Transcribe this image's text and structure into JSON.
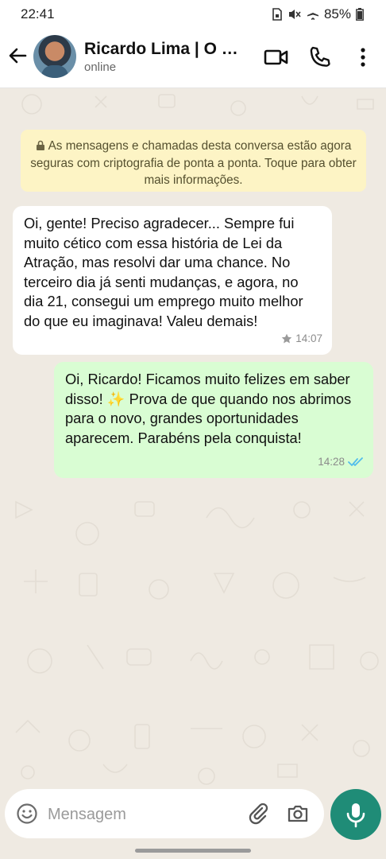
{
  "statusbar": {
    "time": "22:41",
    "battery": "85%"
  },
  "header": {
    "name": "Ricardo Lima | O D...",
    "status": "online"
  },
  "encryption_notice": "As mensagens e chamadas desta conversa estão agora seguras com criptografia de ponta a ponta. Toque para obter mais informações.",
  "messages": [
    {
      "text": "Oi, gente! Preciso agradecer... Sempre fui muito cético com essa história de Lei da Atração, mas resolvi dar uma chance. No terceiro dia já senti mudanças, e agora, no dia 21, consegui um emprego muito melhor do que eu imaginava! Valeu demais!",
      "time": "14:07"
    },
    {
      "text": "Oi, Ricardo! Ficamos muito felizes em saber disso! ✨ Prova de que quando nos abrimos para o novo, grandes oportunidades aparecem. Parabéns pela conquista!",
      "time": "14:28"
    }
  ],
  "composer": {
    "placeholder": "Mensagem"
  },
  "colors": {
    "accent": "#1f8c77",
    "incoming": "#ffffff",
    "outgoing": "#d9fdd3",
    "notice": "#fdf4c5",
    "read_ticks": "#53bdeb"
  }
}
